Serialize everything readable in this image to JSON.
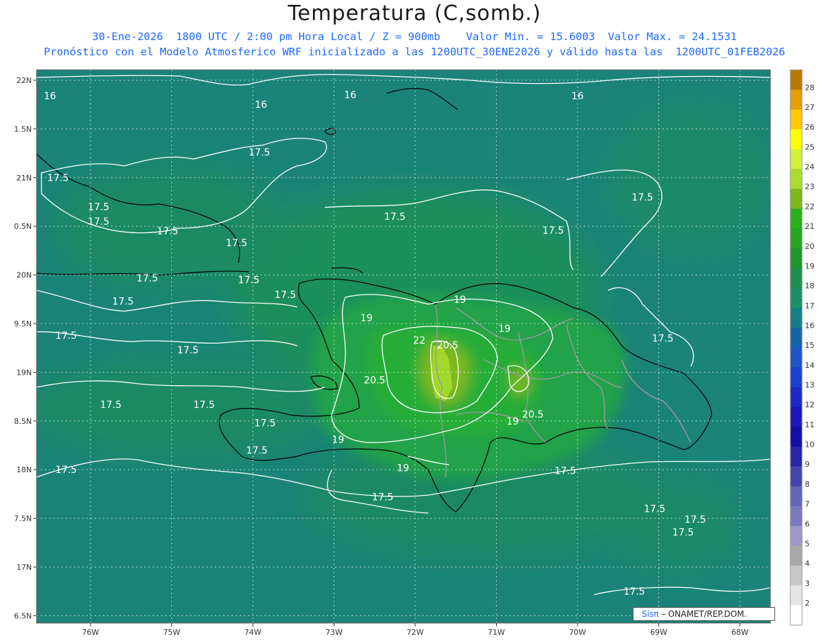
{
  "header": {
    "title": "Temperatura (C,somb.)",
    "date": "30-Ene-2026",
    "time_info": "1800 UTC / 2:00 pm Hora Local / Z = 900mb",
    "min_label": "Valor Min. = 15.6003",
    "max_label": "Valor Max. = 24.1531",
    "forecast_note": "Pronóstico con el Modelo Atmosferico WRF inicializado a las 1200UTC_30ENE2026 y válido hasta las  1200UTC_01FEB2026"
  },
  "map": {
    "lat_labels": [
      "22N",
      "1.5N",
      "21N",
      "0.5N",
      "20N",
      "9.5N",
      "19N",
      "8.5N",
      "18N",
      "7.5N",
      "17N",
      "6.5N"
    ],
    "lon_labels": [
      "76W",
      "75W",
      "74W",
      "73W",
      "72W",
      "71W",
      "70W",
      "69W",
      "68W"
    ],
    "contour_labels": [
      {
        "text": "16",
        "lat": 21.84,
        "lon": -76.5
      },
      {
        "text": "16",
        "lat": 21.75,
        "lon": -73.9
      },
      {
        "text": "16",
        "lat": 21.85,
        "lon": -72.8
      },
      {
        "text": "16",
        "lat": 21.84,
        "lon": -70.0
      },
      {
        "text": "17.5",
        "lat": 21.26,
        "lon": -73.92
      },
      {
        "text": "17.5",
        "lat": 21.0,
        "lon": -76.4
      },
      {
        "text": "17.5",
        "lat": 20.7,
        "lon": -75.9
      },
      {
        "text": "17.5",
        "lat": 20.55,
        "lon": -75.9
      },
      {
        "text": "17.5",
        "lat": 20.45,
        "lon": -75.05
      },
      {
        "text": "17.5",
        "lat": 20.33,
        "lon": -74.2
      },
      {
        "text": "17.5",
        "lat": 20.6,
        "lon": -72.25
      },
      {
        "text": "17.5",
        "lat": 20.46,
        "lon": -70.3
      },
      {
        "text": "17.5",
        "lat": 20.8,
        "lon": -69.2
      },
      {
        "text": "17.5",
        "lat": 19.97,
        "lon": -75.3
      },
      {
        "text": "17.5",
        "lat": 19.95,
        "lon": -74.05
      },
      {
        "text": "17.5",
        "lat": 19.73,
        "lon": -75.6
      },
      {
        "text": "17.5",
        "lat": 19.8,
        "lon": -73.6
      },
      {
        "text": "17.5",
        "lat": 19.38,
        "lon": -76.3
      },
      {
        "text": "17.5",
        "lat": 19.23,
        "lon": -74.8
      },
      {
        "text": "17.5",
        "lat": 19.35,
        "lon": -68.95
      },
      {
        "text": "17.5",
        "lat": 18.67,
        "lon": -75.75
      },
      {
        "text": "17.5",
        "lat": 18.67,
        "lon": -74.6
      },
      {
        "text": "17.5",
        "lat": 18.48,
        "lon": -73.85
      },
      {
        "text": "17.5",
        "lat": 18.2,
        "lon": -73.95
      },
      {
        "text": "17.5",
        "lat": 18.0,
        "lon": -76.3
      },
      {
        "text": "17.5",
        "lat": 17.99,
        "lon": -70.15
      },
      {
        "text": "17.5",
        "lat": 17.72,
        "lon": -72.4
      },
      {
        "text": "17.5",
        "lat": 17.6,
        "lon": -69.05
      },
      {
        "text": "17.5",
        "lat": 17.49,
        "lon": -68.55
      },
      {
        "text": "17.5",
        "lat": 17.36,
        "lon": -68.7
      },
      {
        "text": "17.5",
        "lat": 16.75,
        "lon": -69.3
      },
      {
        "text": "19",
        "lat": 19.75,
        "lon": -71.45
      },
      {
        "text": "19",
        "lat": 19.56,
        "lon": -72.6
      },
      {
        "text": "19",
        "lat": 19.45,
        "lon": -70.9
      },
      {
        "text": "19",
        "lat": 18.5,
        "lon": -70.8
      },
      {
        "text": "19",
        "lat": 18.31,
        "lon": -72.95
      },
      {
        "text": "19",
        "lat": 18.02,
        "lon": -72.15
      },
      {
        "text": "20.5",
        "lat": 19.28,
        "lon": -71.6
      },
      {
        "text": "20.5",
        "lat": 18.92,
        "lon": -72.5
      },
      {
        "text": "20.5",
        "lat": 18.57,
        "lon": -70.55
      },
      {
        "text": "22",
        "lat": 19.33,
        "lon": -71.95
      }
    ]
  },
  "colorbar": {
    "levels": [
      28,
      27,
      26,
      25,
      24,
      23,
      22,
      21,
      20,
      19,
      18,
      17,
      16,
      15,
      14,
      13,
      12,
      11,
      10,
      9,
      8,
      7,
      6,
      5,
      4,
      3,
      2
    ],
    "colors": [
      "#b97a00",
      "#e59d00",
      "#ffc800",
      "#ffff00",
      "#d4f03a",
      "#a8dc2e",
      "#7db81c",
      "#2bb01c",
      "#26a520",
      "#21962c",
      "#1f8f4e",
      "#1b8f6a",
      "#167f86",
      "#1565a8",
      "#1d56c4",
      "#1b3fcf",
      "#1a29c8",
      "#1a18b8",
      "#1010a6",
      "#2426a6",
      "#4046ae",
      "#5f64b6",
      "#7c7aba",
      "#9d98c8",
      "#a8a8a8",
      "#c8c8c8",
      "#e6e6e6",
      "#ffffff"
    ]
  },
  "credit": {
    "brand": "Sisπ",
    "text": " – ONAMET/REP.DOM."
  }
}
